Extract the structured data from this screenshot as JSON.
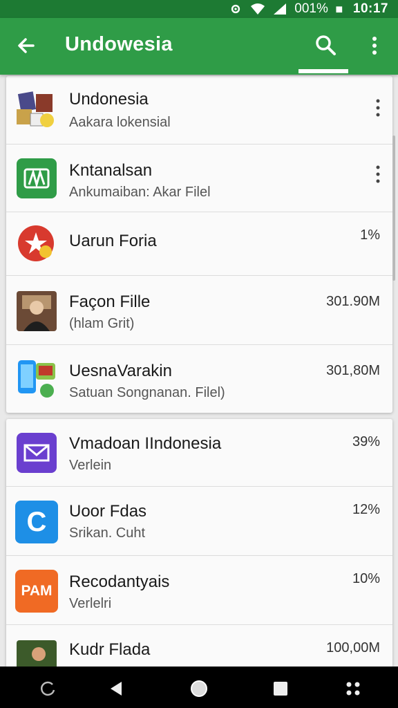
{
  "status_bar": {
    "battery": "001%",
    "time": "10:17"
  },
  "app_bar": {
    "title": "Undowesia",
    "back_icon": "arrow-left-icon",
    "search_icon": "search-icon",
    "more_icon": "more-vert-icon"
  },
  "list_top": {
    "items": [
      {
        "title": "Undonesia",
        "sub": "Aakara lokensial",
        "meta": "",
        "icon": "photo-collage-icon",
        "action": "kebab"
      },
      {
        "title": "Kntanalsan",
        "sub": "Ankumaiban: Akar Filel",
        "meta": "",
        "icon": "green-book-icon",
        "action": "kebab"
      },
      {
        "title": "Uarun Foria",
        "sub": "",
        "meta": "1%",
        "icon": "red-star-icon",
        "action": "meta"
      },
      {
        "title": "Façon Fille",
        "sub": "(hlam Grit)",
        "meta": "301.90M",
        "icon": "portrait-icon",
        "action": "meta"
      },
      {
        "title": "UesnaVarakin",
        "sub": "Satuan Songnanan. Filel)",
        "meta": "301,80M",
        "icon": "phones-icon",
        "action": "meta"
      }
    ]
  },
  "list_bottom": {
    "items": [
      {
        "title": "Vmadoan IIndonesia",
        "sub": "Verlein",
        "meta": "39%",
        "icon": "purple-mail-icon",
        "action": "meta"
      },
      {
        "title": "Uoor Fdas",
        "sub": "Srikan. Cuht",
        "meta": "12%",
        "icon": "blue-c-icon",
        "action": "meta"
      },
      {
        "title": "Recodantyais",
        "sub": "Verlelri",
        "meta": "10%",
        "icon": "orange-pam-icon",
        "action": "meta"
      },
      {
        "title": "Kudr Flada",
        "sub": "",
        "meta": "100,00M",
        "icon": "photo-icon",
        "action": "meta"
      }
    ]
  },
  "icon_text": {
    "pam": "PAM",
    "c": "C"
  },
  "nav_bar": {
    "icons": [
      "recent-apps-icon",
      "back-triangle-icon",
      "home-circle-icon",
      "overview-square-icon",
      "grid-dots-icon"
    ]
  },
  "colors": {
    "app_bar": "#2f9c47",
    "status_bar": "#1d7a33",
    "nav_bar": "#000000"
  }
}
